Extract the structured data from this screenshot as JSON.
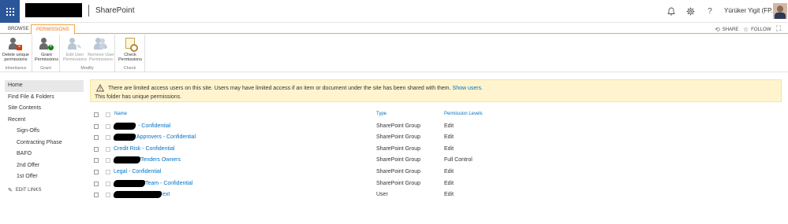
{
  "suite_bar": {
    "app_name": "SharePoint",
    "user_name": "Yürüker Yigit (FP...",
    "icons": [
      "waffle-icon",
      "bell-icon",
      "gear-icon",
      "help-icon"
    ]
  },
  "ribbon": {
    "tabs": [
      {
        "label": "BROWSE",
        "active": false
      },
      {
        "label": "PERMISSIONS",
        "active": true
      }
    ],
    "share_label": "SHARE",
    "follow_label": "FOLLOW",
    "groups": [
      {
        "label": "Inheritance",
        "buttons": [
          {
            "label": "Delete unique permissions",
            "enabled": true
          }
        ]
      },
      {
        "label": "Grant",
        "buttons": [
          {
            "label": "Grant Permissions",
            "enabled": true
          }
        ]
      },
      {
        "label": "Modify",
        "buttons": [
          {
            "label": "Edit User Permissions",
            "enabled": false
          },
          {
            "label": "Remove User Permissions",
            "enabled": false
          }
        ]
      },
      {
        "label": "Check",
        "buttons": [
          {
            "label": "Check Permissions",
            "enabled": true
          }
        ]
      }
    ]
  },
  "left_nav": {
    "items": [
      {
        "label": "Home",
        "selected": true
      },
      {
        "label": "Find File & Folders"
      },
      {
        "label": "Site Contents"
      },
      {
        "label": "Recent"
      }
    ],
    "recent_items": [
      "Sign-Offs",
      "Contracting Phase",
      "BAFO",
      "2nd Offer",
      "1st Offer"
    ],
    "edit_links": "EDIT LINKS"
  },
  "banner": {
    "message": "There are limited access users on this site. Users may have limited access if an item or document under the site has been shared with them.",
    "link": "Show users.",
    "unique_note": "This folder has unique permissions."
  },
  "table": {
    "headers": {
      "name": "Name",
      "type": "Type",
      "levels": "Permission Levels"
    },
    "rows": [
      {
        "name": "- Confidential",
        "type": "SharePoint Group",
        "level": "Edit"
      },
      {
        "name": "Approvers - Confidential",
        "type": "SharePoint Group",
        "level": "Edit"
      },
      {
        "name": "Credit Risk - Confidential",
        "type": "SharePoint Group",
        "level": "Edit"
      },
      {
        "name": "Tenders Owners",
        "type": "SharePoint Group",
        "level": "Full Control"
      },
      {
        "name": "Legal - Confidential",
        "type": "SharePoint Group",
        "level": "Edit"
      },
      {
        "name": "Team - Confidential",
        "type": "SharePoint Group",
        "level": "Edit"
      },
      {
        "name": "ext",
        "type": "User",
        "level": "Edit"
      }
    ]
  },
  "colors": {
    "suite_blue": "#2b579a",
    "accent_orange": "#e87722",
    "link_blue": "#0072c6",
    "banner_yellow": "#fff4ce"
  }
}
